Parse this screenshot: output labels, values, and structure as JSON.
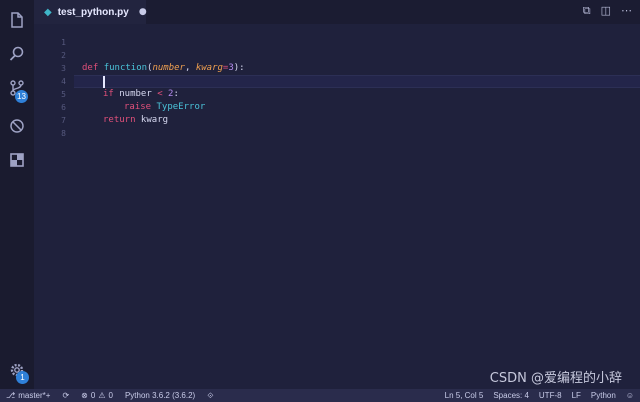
{
  "tab": {
    "filename": "test_python.py",
    "close": "●"
  },
  "activity": {
    "scm_badge": "13",
    "settings_badge": "1"
  },
  "editor": {
    "line_numbers": [
      "1",
      "2",
      "3",
      "4",
      "5",
      "6",
      "7",
      "8"
    ],
    "code": {
      "l3_def": "def",
      "l3_name": "function",
      "l3_open": "(",
      "l3_p1": "number",
      "l3_comma": ", ",
      "l3_p2": "kwarg",
      "l3_eq": "=",
      "l3_default": "3",
      "l3_close": "):",
      "l5_if": "if",
      "l5_var": " number ",
      "l5_op": "<",
      "l5_num": " 2",
      "l5_colon": ":",
      "l6_raise": "raise",
      "l6_type": " TypeError",
      "l7_return": "return",
      "l7_val": " kwarg"
    }
  },
  "status": {
    "branch": "master*+",
    "sync": "⟳",
    "errors": "0",
    "warnings": "0",
    "interpreter": "Python 3.6.2 (3.6.2)",
    "position": "Ln 5, Col 5",
    "spaces": "Spaces: 4",
    "encoding": "UTF-8",
    "eol": "LF",
    "language": "Python"
  },
  "watermark": "CSDN @爱编程的小辞"
}
